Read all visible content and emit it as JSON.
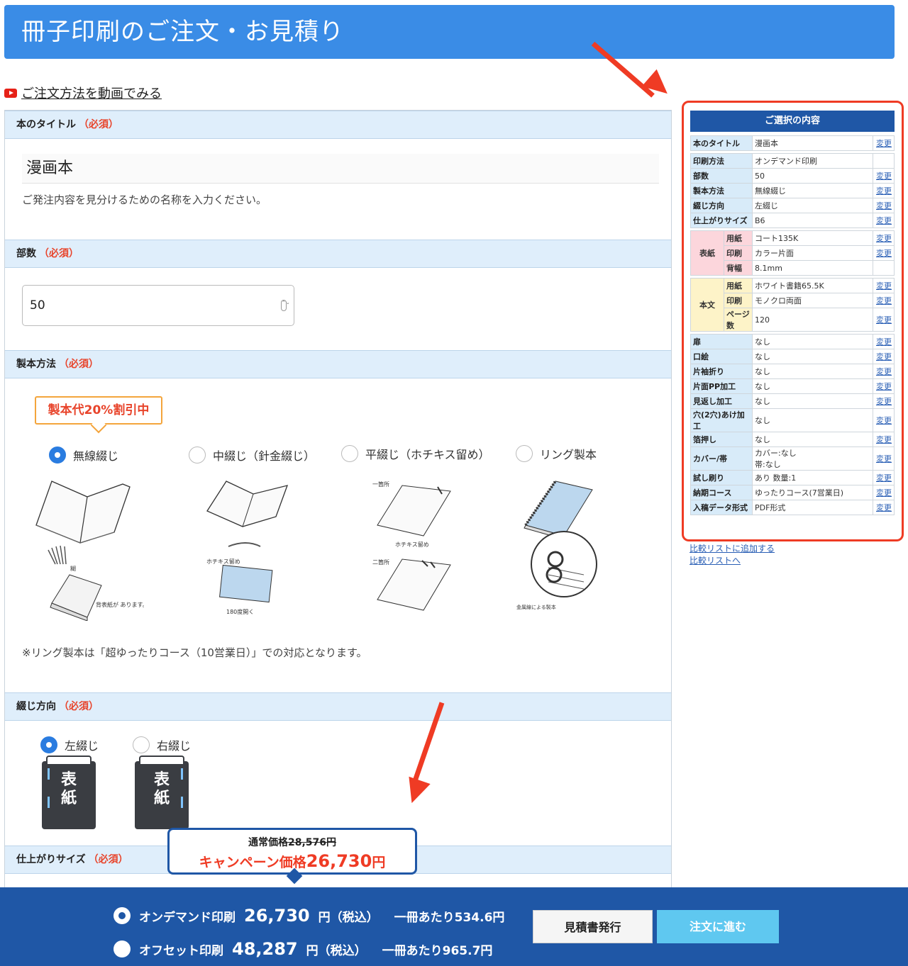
{
  "header": {
    "title": "冊子印刷のご注文・お見積り"
  },
  "video_link": "ご注文方法を動画でみる",
  "sections": {
    "title": {
      "label": "本のタイトル",
      "required": "（必須）",
      "value": "漫画本",
      "help": "ご発注内容を見分けるための名称を入力ください。"
    },
    "quantity": {
      "label": "部数",
      "required": "（必須）",
      "value": "50",
      "spinner": "⌃⌄"
    },
    "binding": {
      "label": "製本方法",
      "required": "（必須）",
      "callout": "製本代20%割引中",
      "options": [
        "無線綴じ",
        "中綴じ（針金綴じ）",
        "平綴じ（ホチキス留め）",
        "リング製本"
      ],
      "note": "※リング製本は「超ゆったりコース（10営業日）」での対応となります。",
      "img_labels": {
        "glue": "糊",
        "spine": "背表紙が\nあります。",
        "staple": "ホチキス留め",
        "open180": "180度開く",
        "one_place": "一箇所",
        "staple2": "ホチキス留め",
        "two_place": "二箇所",
        "ring_wire": "金属線による製本"
      }
    },
    "direction": {
      "label": "綴じ方向",
      "required": "（必須）",
      "options": [
        "左綴じ",
        "右綴じ"
      ],
      "book_text": "表紙"
    },
    "size": {
      "label": "仕上がりサイズ",
      "required": "（必須）"
    }
  },
  "summary": {
    "title": "ご選択の内容",
    "change": "変更",
    "top": [
      {
        "k": "本のタイトル",
        "v": "漫画本",
        "link": true
      }
    ],
    "main": [
      {
        "k": "印刷方法",
        "v": "オンデマンド印刷",
        "link": false
      },
      {
        "k": "部数",
        "v": "50",
        "link": true
      },
      {
        "k": "製本方法",
        "v": "無線綴じ",
        "link": true
      },
      {
        "k": "綴じ方向",
        "v": "左綴じ",
        "link": true
      },
      {
        "k": "仕上がりサイズ",
        "v": "B6",
        "link": true
      }
    ],
    "cover": {
      "group": "表紙",
      "rows": [
        {
          "k": "用紙",
          "v": "コート135K",
          "link": true
        },
        {
          "k": "印刷",
          "v": "カラー片面",
          "link": true
        },
        {
          "k": "背幅",
          "v": "8.1mm",
          "link": false
        }
      ]
    },
    "body": {
      "group": "本文",
      "rows": [
        {
          "k": "用紙",
          "v": "ホワイト書籍65.5K",
          "link": true
        },
        {
          "k": "印刷",
          "v": "モノクロ両面",
          "link": true
        },
        {
          "k": "ページ数",
          "v": "120",
          "link": true
        }
      ]
    },
    "extras": [
      {
        "k": "扉",
        "v": "なし"
      },
      {
        "k": "口絵",
        "v": "なし"
      },
      {
        "k": "片袖折り",
        "v": "なし"
      },
      {
        "k": "片面PP加工",
        "v": "なし"
      },
      {
        "k": "見返し加工",
        "v": "なし"
      },
      {
        "k": "穴(2穴)あけ加工",
        "v": "なし"
      },
      {
        "k": "箔押し",
        "v": "なし"
      },
      {
        "k": "カバー/帯",
        "v": "カバー:なし\n帯:なし"
      },
      {
        "k": "試し刷り",
        "v": "あり 数量:1"
      },
      {
        "k": "納期コース",
        "v": "ゆったりコース(7営業日)"
      },
      {
        "k": "入稿データ形式",
        "v": "PDF形式"
      }
    ]
  },
  "compare": {
    "add": "比較リストに追加する",
    "go": "比較リストへ"
  },
  "price_bubble": {
    "normal_label": "通常価格",
    "normal_value": "28,576円",
    "campaign_label": "キャンペーン価格",
    "campaign_value": "26,730",
    "campaign_unit": "円"
  },
  "bottom": {
    "rows": [
      {
        "name": "オンデマンド印刷",
        "amount": "26,730",
        "unit": "円（税込）",
        "per": "一冊あたり534.6円",
        "selected": true
      },
      {
        "name": "オフセット印刷",
        "amount": "48,287",
        "unit": "円（税込）",
        "per": "一冊あたり965.7円",
        "selected": false
      }
    ],
    "quote_button": "見積書発行",
    "order_button": "注文に進む"
  },
  "colors": {
    "header": "#3a8ce6",
    "accent_red": "#ef3b24",
    "navy": "#1f57a6",
    "order_btn": "#5fc8f0"
  }
}
